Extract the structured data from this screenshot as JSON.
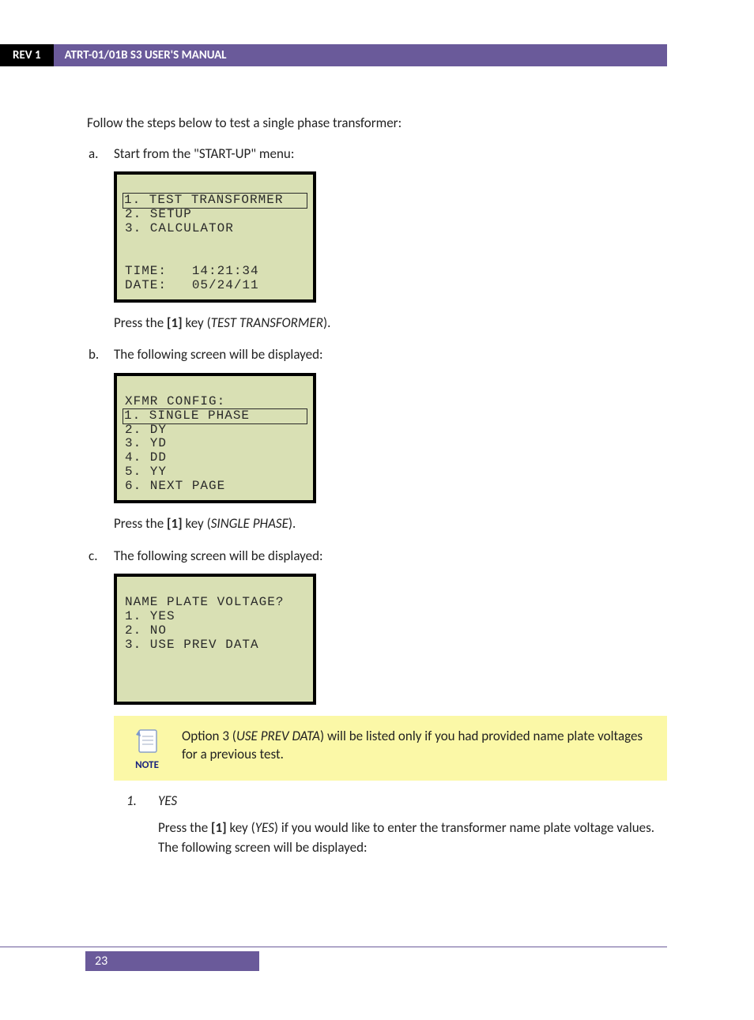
{
  "header": {
    "rev": "REV 1",
    "title": "ATRT-01/01B S3 USER'S MANUAL"
  },
  "intro": "Follow the steps below to test a single phase transformer:",
  "steps": {
    "a": {
      "marker": "a.",
      "lead": "Start from the \"START-UP\" menu:",
      "lcd": {
        "sel": "1. TEST TRANSFORMER",
        "lines": [
          "2. SETUP",
          "3. CALCULATOR",
          " ",
          " ",
          "TIME:   14:21:34",
          "DATE:   05/24/11"
        ]
      },
      "after_pre": "Press the ",
      "after_key": "[1]",
      "after_mid": " key (",
      "after_ital": "TEST TRANSFORMER",
      "after_post": ")."
    },
    "b": {
      "marker": "b.",
      "lead": "The following screen will be displayed:",
      "lcd": {
        "header": "XFMR CONFIG:",
        "sel": "1. SINGLE PHASE",
        "lines": [
          "2. DY",
          "3. YD",
          "4. DD",
          "5. YY",
          "6. NEXT PAGE"
        ]
      },
      "after_pre": "Press the ",
      "after_key": "[1]",
      "after_mid": " key (",
      "after_ital": "SINGLE PHASE",
      "after_post": ")."
    },
    "c": {
      "marker": "c.",
      "lead": "The following screen will be displayed:",
      "lcd": {
        "lines": [
          "NAME PLATE VOLTAGE?",
          "1. YES",
          "2. NO",
          "3. USE PREV DATA",
          " ",
          " ",
          " "
        ]
      },
      "note": {
        "label": "NOTE",
        "t1": "Option 3 (",
        "t2": "USE PREV DATA",
        "t3": ") will be listed only if you had provided name plate voltages for a previous test."
      },
      "sub": {
        "marker": "1.",
        "title": "YES",
        "p1a": "Press the ",
        "p1b": "[1]",
        "p1c": " key (",
        "p1d": "YES",
        "p1e": ") if you would like to enter the transformer name plate voltage values. The following screen will be displayed:"
      }
    }
  },
  "page_number": "23"
}
